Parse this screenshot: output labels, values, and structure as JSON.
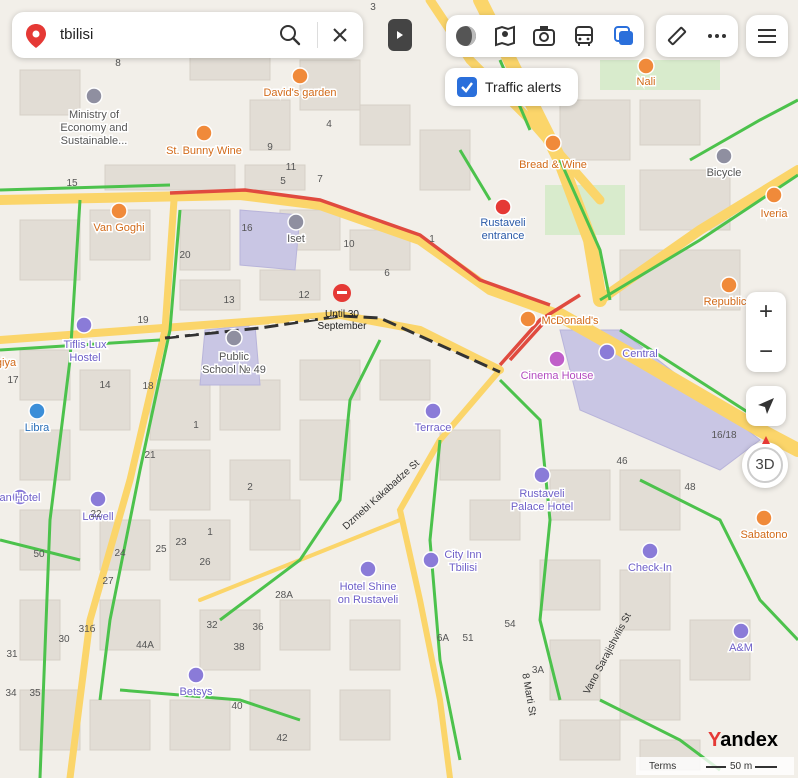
{
  "search": {
    "query": "tbilisi"
  },
  "traffic_alerts": {
    "label": "Traffic alerts",
    "checked": true
  },
  "map_controls": {
    "zoom_in": "+",
    "zoom_out": "−",
    "three_d": "3D"
  },
  "footer": {
    "terms": "Terms",
    "scale": "50 m"
  },
  "logo": {
    "first": "Y",
    "rest": "andex"
  },
  "closure": {
    "line1": "Until 30",
    "line2": "September"
  },
  "places": [
    {
      "name": "david-s-garden",
      "lines": [
        "David's garden"
      ],
      "type": "food"
    },
    {
      "name": "st-bunny-wine",
      "lines": [
        "St. Bunny Wine"
      ],
      "type": "food"
    },
    {
      "name": "van-goghi",
      "lines": [
        "Van Goghi"
      ],
      "type": "food"
    },
    {
      "name": "bread-and-wine",
      "lines": [
        "Bread & Wine"
      ],
      "type": "food"
    },
    {
      "name": "nali",
      "lines": [
        "Nali"
      ],
      "type": "food"
    },
    {
      "name": "iveria",
      "lines": [
        "Iveria"
      ],
      "type": "food"
    },
    {
      "name": "republic",
      "lines": [
        "Republic"
      ],
      "type": "food"
    },
    {
      "name": "mcdonalds",
      "lines": [
        "McDonald's"
      ],
      "type": "food"
    },
    {
      "name": "sabatono",
      "lines": [
        "Sabatono"
      ],
      "type": "food"
    },
    {
      "name": "ministry",
      "lines": [
        "Ministry of",
        "Economy and",
        "Sustainable..."
      ],
      "type": "gov"
    },
    {
      "name": "rustaveli-entrance",
      "lines": [
        "Rustaveli",
        "entrance"
      ],
      "type": "metro"
    },
    {
      "name": "bicycle",
      "lines": [
        "Bicycle"
      ],
      "type": "monument"
    },
    {
      "name": "iset",
      "lines": [
        "Iset"
      ],
      "type": "school"
    },
    {
      "name": "public-school-49",
      "lines": [
        "Public",
        "School № 49"
      ],
      "type": "school"
    },
    {
      "name": "tiflis-lux-hostel",
      "lines": [
        "Tiflis Lux",
        "Hostel"
      ],
      "type": "hotel"
    },
    {
      "name": "central",
      "lines": [
        "Central"
      ],
      "type": "hotel"
    },
    {
      "name": "cinema-house",
      "lines": [
        "Cinema House"
      ],
      "type": "cinema"
    },
    {
      "name": "terrace",
      "lines": [
        "Terrace"
      ],
      "type": "hotel"
    },
    {
      "name": "libra",
      "lines": [
        "Libra"
      ],
      "type": "shop"
    },
    {
      "name": "rustaveli-palace-hotel",
      "lines": [
        "Rustaveli",
        "Palace Hotel"
      ],
      "type": "hotel"
    },
    {
      "name": "lowell",
      "lines": [
        "Lowell"
      ],
      "type": "hotel"
    },
    {
      "name": "an-hotel",
      "lines": [
        "an Hotel"
      ],
      "type": "hotel"
    },
    {
      "name": "city-inn-tbilisi",
      "lines": [
        "City Inn",
        "Tbilisi"
      ],
      "type": "hotel"
    },
    {
      "name": "check-in",
      "lines": [
        "Check-In"
      ],
      "type": "hotel"
    },
    {
      "name": "hotel-shine",
      "lines": [
        "Hotel Shine",
        "on Rustaveli"
      ],
      "type": "hotel"
    },
    {
      "name": "a-and-m",
      "lines": [
        "A&M"
      ],
      "type": "hotel"
    },
    {
      "name": "betsys",
      "lines": [
        "Betsys"
      ],
      "type": "hotel"
    },
    {
      "name": "giya",
      "lines": [
        "giya"
      ],
      "type": "food"
    }
  ],
  "streets": [
    {
      "name": "dzmebi-kakabadze-st",
      "label": "Dzmebi Kakabadze St"
    },
    {
      "name": "vano-sarajishvilis-st",
      "label": "Vano Sarajishvilis St"
    },
    {
      "name": "marti-st",
      "label": "8 Marti St"
    }
  ],
  "house_numbers": [
    "8",
    "3",
    "5",
    "2",
    "4",
    "9",
    "6",
    "7",
    "1",
    "11",
    "13",
    "15",
    "16",
    "20",
    "18",
    "19",
    "10",
    "12",
    "14",
    "17",
    "21",
    "22",
    "23",
    "24",
    "25",
    "26",
    "27",
    "28A",
    "30",
    "31",
    "31б",
    "32",
    "34",
    "35",
    "36",
    "38",
    "40",
    "42",
    "44A",
    "46",
    "48",
    "50",
    "51",
    "54",
    "3A",
    "6A",
    "16/18",
    "1",
    "2",
    "1"
  ],
  "colors": {
    "land": "#f2efe9",
    "building": "#e2ddd5",
    "major_road": "#fbd56a",
    "road": "#ffffff",
    "traffic_free": "#4cc24c",
    "traffic_jam": "#e04a3f",
    "closure": "#333333",
    "label_text": "#3d3d3d",
    "food_poi": "#f08a3a",
    "hotel_poi": "#8a7bd8",
    "school_poi": "#8f8fa0",
    "accent": "#2a6fdb",
    "purple_zone": "#c9c6e4"
  }
}
